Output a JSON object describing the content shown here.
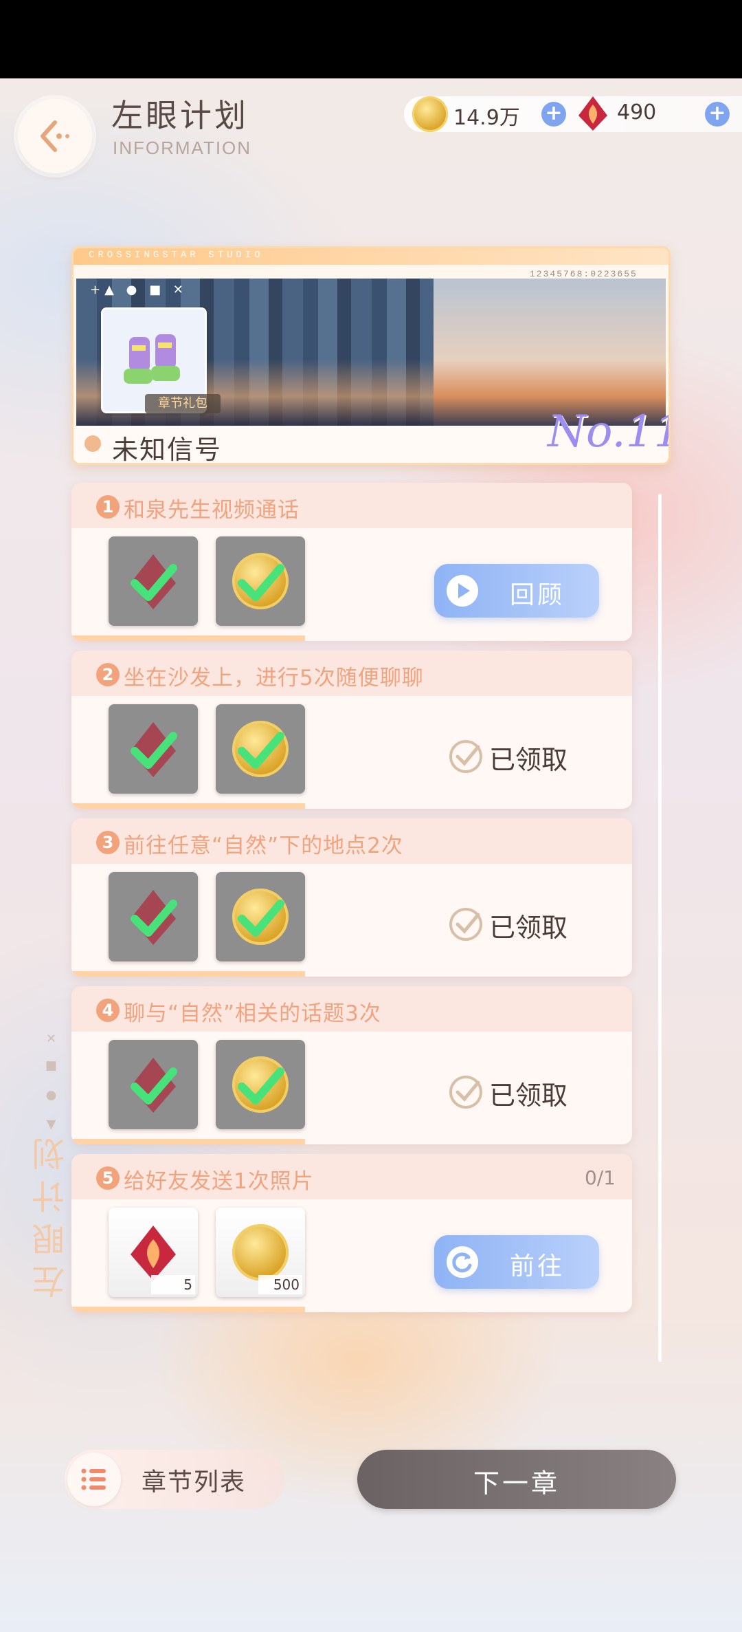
{
  "header": {
    "title": "左眼计划",
    "subtitle": "INFORMATION"
  },
  "currency": {
    "coins": "14.9万",
    "gems": "490",
    "plus": "+"
  },
  "banner": {
    "studio": "CROSSINGSTAR STUDIO",
    "serial": "12345768:0223655",
    "symbols": "+▲ ● ■ ✕",
    "gift_label": "章节礼包",
    "chapter_name": "未知信号",
    "chapter_no": "No.11"
  },
  "tasks": [
    {
      "num": "1",
      "title": "和泉先生视频通话",
      "status": "review",
      "action_label": "回顾"
    },
    {
      "num": "2",
      "title": "坐在沙发上，进行5次随便聊聊",
      "status": "claimed",
      "action_label": "已领取"
    },
    {
      "num": "3",
      "title": "前往任意“自然”下的地点2次",
      "status": "claimed",
      "action_label": "已领取"
    },
    {
      "num": "4",
      "title": "聊与“自然”相关的话题3次",
      "status": "claimed",
      "action_label": "已领取"
    },
    {
      "num": "5",
      "title": "给好友发送1次照片",
      "status": "go",
      "action_label": "前往",
      "progress": "0/1",
      "rewards": [
        {
          "type": "gem",
          "qty": "5"
        },
        {
          "type": "coin",
          "qty": "500"
        }
      ]
    }
  ],
  "side": {
    "vertical_title": "左眼计划",
    "marks": "▲ ● ■ ✕"
  },
  "footer": {
    "chapter_list": "章节列表",
    "next_chapter": "下一章"
  },
  "colors": {
    "accent_blue": "#8fb3f5",
    "task_orange": "#f1a37e",
    "chapter_no_purple": "#9d8df2"
  }
}
